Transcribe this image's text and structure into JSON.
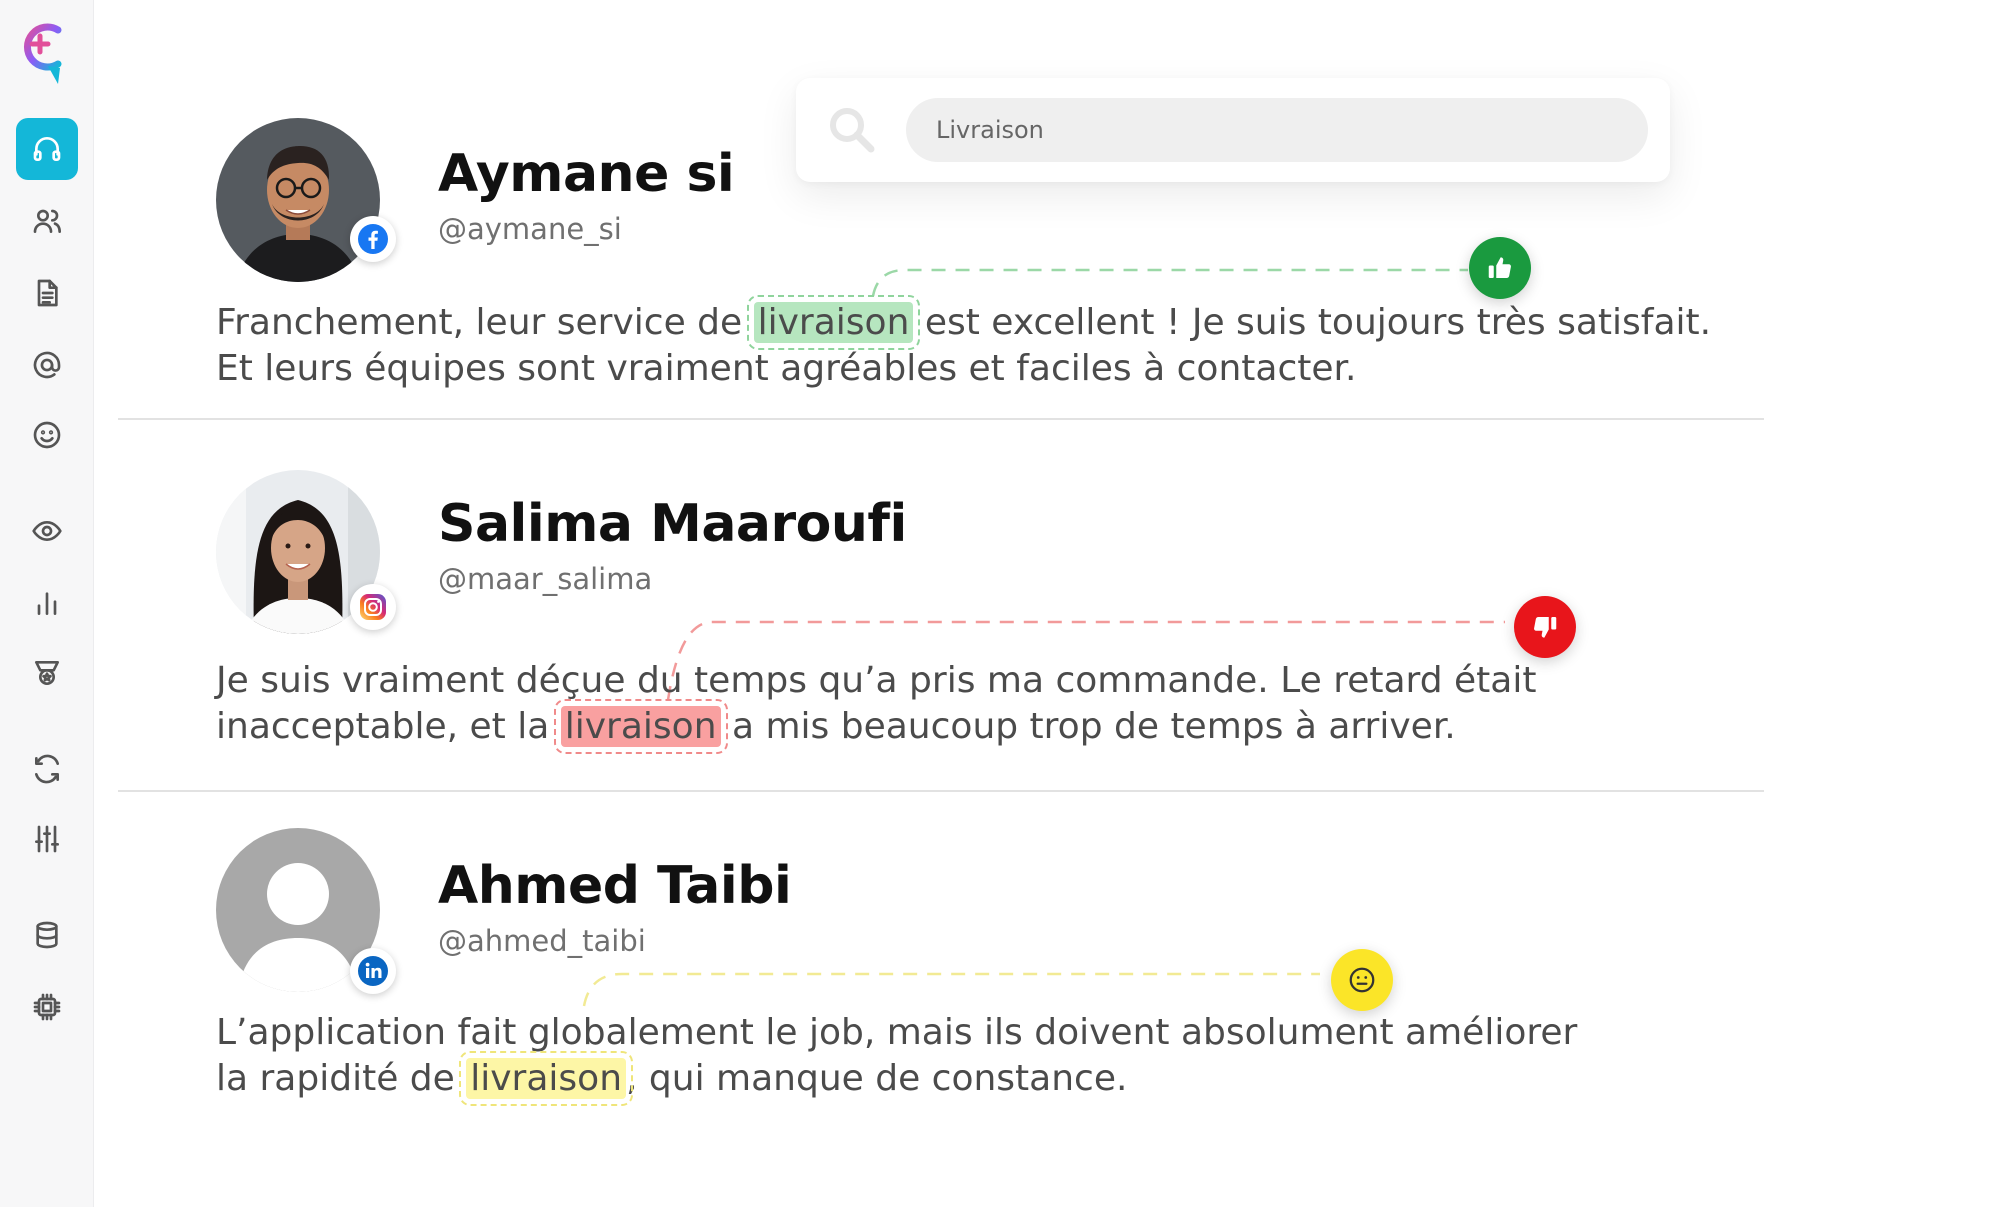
{
  "sidebar": {
    "logo": "brand-logo",
    "items": [
      {
        "icon": "headphones-icon",
        "active": true
      },
      {
        "icon": "users-icon",
        "active": false
      },
      {
        "icon": "document-icon",
        "active": false
      },
      {
        "icon": "at-sign-icon",
        "active": false
      },
      {
        "icon": "smile-icon",
        "active": false
      },
      {
        "icon": "eye-icon",
        "active": false
      },
      {
        "icon": "bar-chart-icon",
        "active": false
      },
      {
        "icon": "badge-icon",
        "active": false
      },
      {
        "icon": "refresh-icon",
        "active": false
      },
      {
        "icon": "sliders-icon",
        "active": false
      },
      {
        "icon": "database-icon",
        "active": false
      },
      {
        "icon": "chip-icon",
        "active": false
      }
    ]
  },
  "search": {
    "value": "Livraison",
    "icon": "search-icon"
  },
  "posts": [
    {
      "name": "Aymane si",
      "handle": "@aymane_si",
      "network": "facebook",
      "sentiment": "positive",
      "line1_before": "Franchement, leur service de ",
      "keyword": "livraison",
      "line1_after": " est excellent ! Je suis toujours très satisfait.",
      "line2": "Et leurs équipes sont vraiment agréables et faciles à contacter."
    },
    {
      "name": "Salima Maaroufi",
      "handle": "@maar_salima",
      "network": "instagram",
      "sentiment": "negative",
      "line1": "Je suis vraiment déçue du temps qu’a pris ma commande. Le retard était",
      "line2_before": "inacceptable, et la ",
      "keyword": "livraison",
      "line2_after": " a mis beaucoup trop de temps à arriver."
    },
    {
      "name": "Ahmed Taibi",
      "handle": "@ahmed_taibi",
      "network": "linkedin",
      "sentiment": "neutral",
      "line1": "L’application fait globalement le job, mais ils doivent absolument améliorer",
      "line2_before": "la rapidité de ",
      "keyword": "livraison",
      "line2_after": ", qui manque de constance."
    }
  ],
  "colors": {
    "accent": "#14b7d8",
    "positive": "#1a9a3f",
    "negative": "#e8151b",
    "neutral": "#fbe528"
  }
}
